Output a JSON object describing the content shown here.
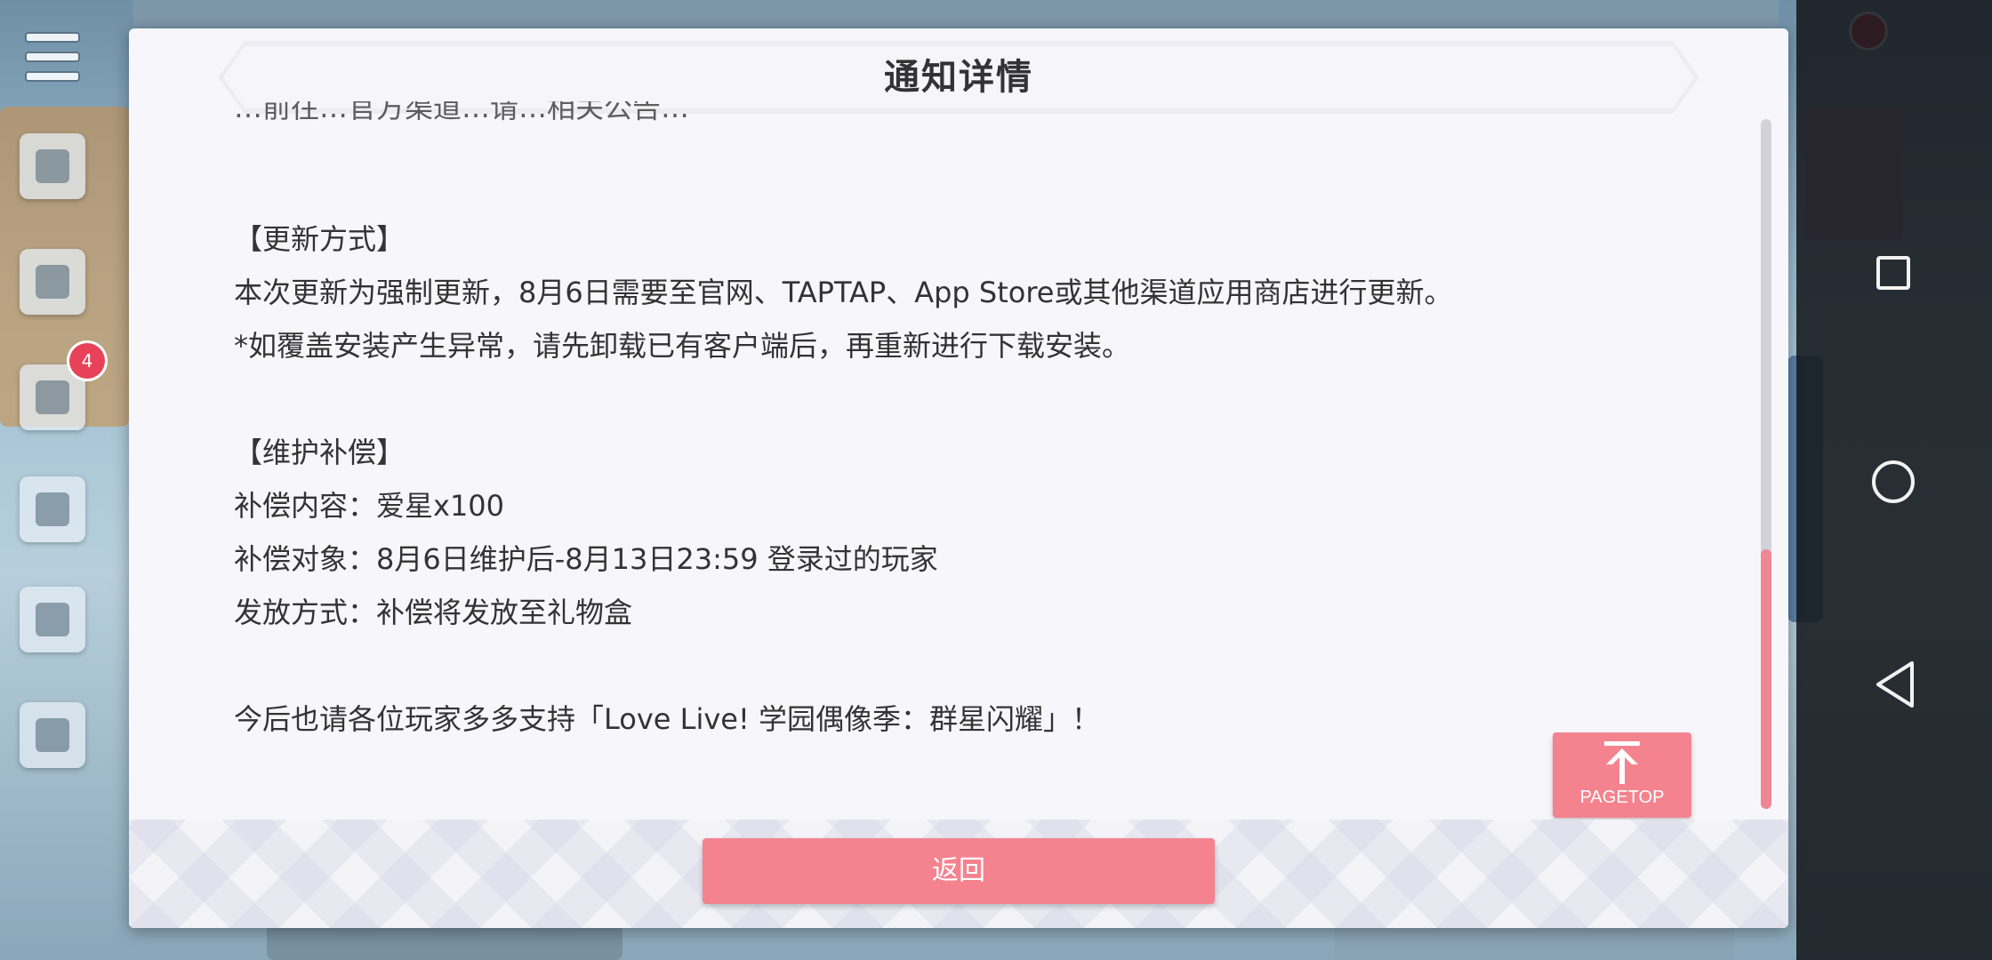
{
  "dialog": {
    "title": "通知详情",
    "cut_off_line": "…前往…官方渠道…请…相关公告…",
    "lines": [
      "【更新方式】",
      "本次更新为强制更新，8月6日需要至官网、TAPTAP、App Store或其他渠道应用商店进行更新。",
      "*如覆盖安装产生异常，请先卸载已有客户端后，再重新进行下载安装。",
      "【维护补偿】",
      "补偿内容：爱星x100",
      "补偿对象：8月6日维护后-8月13日23:59 登录过的玩家",
      "发放方式：补偿将发放至礼物盒",
      "今后也请各位玩家多多支持「Love Live! 学园偶像季：群星闪耀」！"
    ],
    "pagetop_label": "PAGETOP",
    "back_label": "返回",
    "scroll_position": 1.0
  },
  "sidebar": {
    "badge_count": "4"
  },
  "colors": {
    "accent": "#f4838f",
    "dialog_bg": "#f7f7fb",
    "text": "#333333"
  },
  "icons": [
    "menu-icon",
    "arrow-up-icon",
    "square-icon",
    "circle-icon",
    "triangle-back-icon"
  ]
}
